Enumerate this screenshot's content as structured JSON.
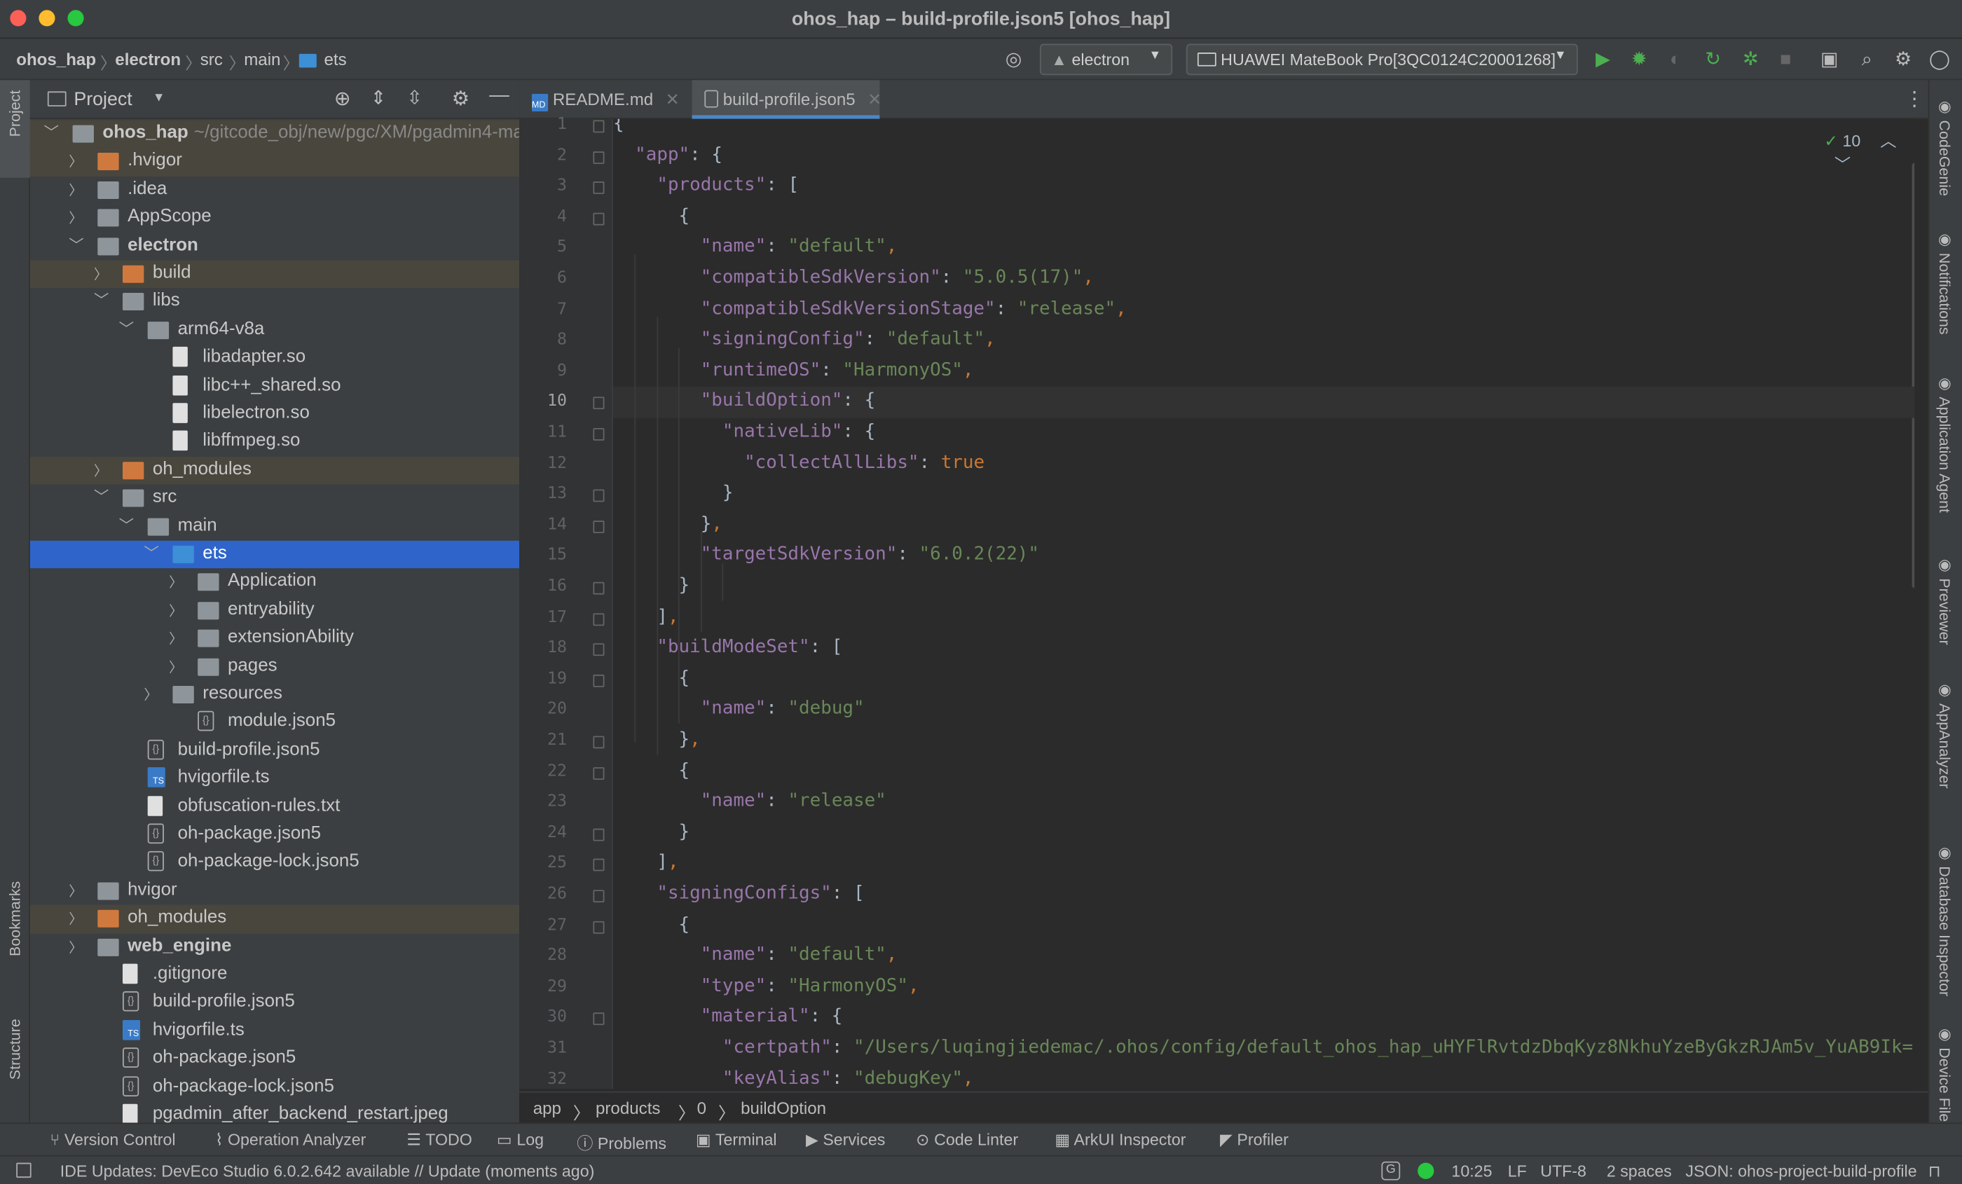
{
  "window": {
    "title": "ohos_hap – build-profile.json5 [ohos_hap]"
  },
  "navbar": {
    "crumbs": [
      "ohos_hap",
      "electron",
      "src",
      "main",
      "ets"
    ],
    "module_select": "electron",
    "device_select": "HUAWEI MateBook Pro[3QC0124C20001268]"
  },
  "left_stripe": {
    "project": "Project",
    "bookmarks": "Bookmarks",
    "structure": "Structure"
  },
  "project_panel": {
    "title": "Project",
    "tree": [
      {
        "label": "ohos_hap",
        "extra": "~/gitcode_obj/new/pgc/XM/pgadmin4-ma"
      },
      {
        "label": ".hvigor"
      },
      {
        "label": ".idea"
      },
      {
        "label": "AppScope"
      },
      {
        "label": "electron"
      },
      {
        "label": "build"
      },
      {
        "label": "libs"
      },
      {
        "label": "arm64-v8a"
      },
      {
        "label": "libadapter.so"
      },
      {
        "label": "libc++_shared.so"
      },
      {
        "label": "libelectron.so"
      },
      {
        "label": "libffmpeg.so"
      },
      {
        "label": "oh_modules"
      },
      {
        "label": "src"
      },
      {
        "label": "main"
      },
      {
        "label": "ets"
      },
      {
        "label": "Application"
      },
      {
        "label": "entryability"
      },
      {
        "label": "extensionAbility"
      },
      {
        "label": "pages"
      },
      {
        "label": "resources"
      },
      {
        "label": "module.json5"
      },
      {
        "label": "build-profile.json5"
      },
      {
        "label": "hvigorfile.ts"
      },
      {
        "label": "obfuscation-rules.txt"
      },
      {
        "label": "oh-package.json5"
      },
      {
        "label": "oh-package-lock.json5"
      },
      {
        "label": "hvigor"
      },
      {
        "label": "oh_modules"
      },
      {
        "label": "web_engine"
      },
      {
        "label": ".gitignore"
      },
      {
        "label": "build-profile.json5"
      },
      {
        "label": "hvigorfile.ts"
      },
      {
        "label": "oh-package.json5"
      },
      {
        "label": "oh-package-lock.json5"
      },
      {
        "label": "pgadmin_after_backend_restart.jpeg"
      }
    ]
  },
  "editor": {
    "tabs": [
      {
        "label": "README.md"
      },
      {
        "label": "build-profile.json5"
      }
    ],
    "inspection_count": "10",
    "line_numbers": [
      "1",
      "2",
      "3",
      "4",
      "5",
      "6",
      "7",
      "8",
      "9",
      "10",
      "11",
      "12",
      "13",
      "14",
      "15",
      "16",
      "17",
      "18",
      "19",
      "20",
      "21",
      "22",
      "23",
      "24",
      "25",
      "26",
      "27",
      "28",
      "29",
      "30",
      "31",
      "32"
    ],
    "code": [
      "{",
      "  \"app\": {",
      "    \"products\": [",
      "      {",
      "        \"name\": \"default\",",
      "        \"compatibleSdkVersion\": \"5.0.5(17)\",",
      "        \"compatibleSdkVersionStage\": \"release\",",
      "        \"signingConfig\": \"default\",",
      "        \"runtimeOS\": \"HarmonyOS\",",
      "        \"buildOption\": {",
      "          \"nativeLib\": {",
      "            \"collectAllLibs\": true",
      "          }",
      "        },",
      "        \"targetSdkVersion\": \"6.0.2(22)\"",
      "      }",
      "    ],",
      "    \"buildModeSet\": [",
      "      {",
      "        \"name\": \"debug\"",
      "      },",
      "      {",
      "        \"name\": \"release\"",
      "      }",
      "    ],",
      "    \"signingConfigs\": [",
      "      {",
      "        \"name\": \"default\",",
      "        \"type\": \"HarmonyOS\",",
      "        \"material\": {",
      "          \"certpath\": \"/Users/luqingjiedemac/.ohos/config/default_ohos_hap_uHYFlRvtdzDbqKyz8NkhuYzeByGkzRJAm5v_YuAB9Ik=.c",
      "          \"keyAlias\": \"debugKey\","
    ]
  },
  "right_stripe": [
    "CodeGenie",
    "Notifications",
    "Application Agent",
    "Previewer",
    "AppAnalyzer",
    "Database Inspector",
    "Device File"
  ],
  "breadcrumbs": [
    "app",
    "products",
    "0",
    "buildOption"
  ],
  "tool_windows": [
    "Version Control",
    "Operation Analyzer",
    "TODO",
    "Log",
    "Problems",
    "Terminal",
    "Services",
    "Code Linter",
    "ArkUI Inspector",
    "Profiler"
  ],
  "status": {
    "message": "IDE Updates: DevEco Studio 6.0.2.642 available // Update (moments ago)",
    "position": "10:25",
    "line_sep": "LF",
    "encoding": "UTF-8",
    "indent": "2 spaces",
    "schema": "JSON: ohos-project-build-profile"
  },
  "colors": {
    "selection": "#2f65ca",
    "run_green": "#4caf50",
    "key": "#9876aa",
    "string": "#6a8759",
    "keyword": "#cc7832"
  }
}
